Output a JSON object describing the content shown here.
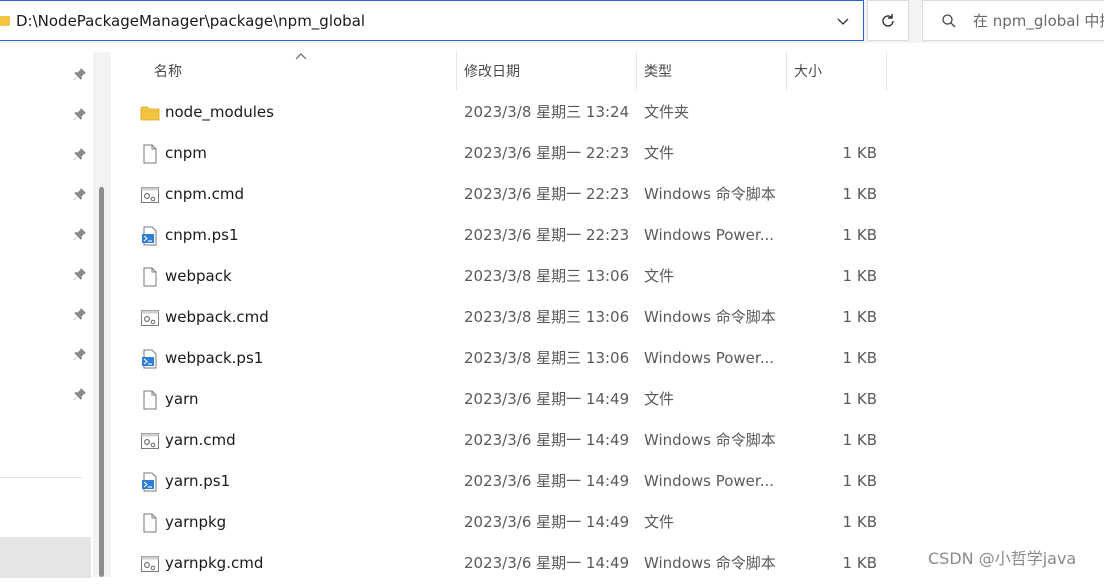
{
  "address_bar": {
    "path": "D:\\NodePackageManager\\package\\npm_global"
  },
  "search": {
    "placeholder": "在 npm_global 中搜"
  },
  "columns": {
    "name": "名称",
    "date": "修改日期",
    "type": "类型",
    "size": "大小"
  },
  "files": [
    {
      "name": "node_modules",
      "date": "2023/3/8 星期三 13:24",
      "type": "文件夹",
      "size": "",
      "icon": "folder-icon"
    },
    {
      "name": "cnpm",
      "date": "2023/3/6 星期一 22:23",
      "type": "文件",
      "size": "1 KB",
      "icon": "file-icon"
    },
    {
      "name": "cnpm.cmd",
      "date": "2023/3/6 星期一 22:23",
      "type": "Windows 命令脚本",
      "size": "1 KB",
      "icon": "cmd-script-icon"
    },
    {
      "name": "cnpm.ps1",
      "date": "2023/3/6 星期一 22:23",
      "type": "Windows Power...",
      "size": "1 KB",
      "icon": "powershell-script-icon"
    },
    {
      "name": "webpack",
      "date": "2023/3/8 星期三 13:06",
      "type": "文件",
      "size": "1 KB",
      "icon": "file-icon"
    },
    {
      "name": "webpack.cmd",
      "date": "2023/3/8 星期三 13:06",
      "type": "Windows 命令脚本",
      "size": "1 KB",
      "icon": "cmd-script-icon"
    },
    {
      "name": "webpack.ps1",
      "date": "2023/3/8 星期三 13:06",
      "type": "Windows Power...",
      "size": "1 KB",
      "icon": "powershell-script-icon"
    },
    {
      "name": "yarn",
      "date": "2023/3/6 星期一 14:49",
      "type": "文件",
      "size": "1 KB",
      "icon": "file-icon"
    },
    {
      "name": "yarn.cmd",
      "date": "2023/3/6 星期一 14:49",
      "type": "Windows 命令脚本",
      "size": "1 KB",
      "icon": "cmd-script-icon"
    },
    {
      "name": "yarn.ps1",
      "date": "2023/3/6 星期一 14:49",
      "type": "Windows Power...",
      "size": "1 KB",
      "icon": "powershell-script-icon"
    },
    {
      "name": "yarnpkg",
      "date": "2023/3/6 星期一 14:49",
      "type": "文件",
      "size": "1 KB",
      "icon": "file-icon"
    },
    {
      "name": "yarnpkg.cmd",
      "date": "2023/3/6 星期一 14:49",
      "type": "Windows 命令脚本",
      "size": "1 KB",
      "icon": "cmd-script-icon"
    }
  ],
  "watermark": "CSDN @小哲学java",
  "colors": {
    "accent": "#2a6ad0",
    "folder": "#f5c542",
    "selected": "#e5e5e5"
  }
}
